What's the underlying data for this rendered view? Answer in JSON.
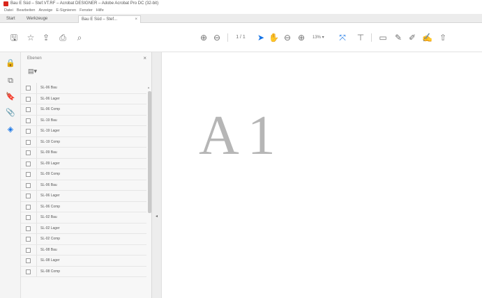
{
  "window": {
    "title": "Bau E Süd – Stef.VT.RF – Acrobat DESIGNER – Adobe Acrobat Pro DC (32-bit)"
  },
  "menu": {
    "items": [
      "Datei",
      "Bearbeiten",
      "Anzeige",
      "E-Signieren",
      "Fenster",
      "Hilfe"
    ]
  },
  "tabs": {
    "home": "Start",
    "tools": "Werkzeuge",
    "document": "Bau E Süd – Stef...",
    "close": "×"
  },
  "toolbar": {
    "zoom_value": "13%"
  },
  "layers_panel": {
    "label": "Ebenen",
    "close": "×",
    "items": [
      {
        "label": "SL-06 Bau"
      },
      {
        "label": "SL-06 Lager"
      },
      {
        "label": "SL-06 Comp"
      },
      {
        "label": "SL-19 Bau"
      },
      {
        "label": "SL-19 Lager"
      },
      {
        "label": "SL-19 Comp"
      },
      {
        "label": "SL-09 Bau"
      },
      {
        "label": "SL-09 Lager"
      },
      {
        "label": "SL-09 Comp"
      },
      {
        "label": "SL-06 Bau"
      },
      {
        "label": "SL-06 Lager"
      },
      {
        "label": "SL-06 Comp"
      },
      {
        "label": "SL-02 Bau"
      },
      {
        "label": "SL-02 Lager"
      },
      {
        "label": "SL-02 Comp"
      },
      {
        "label": "SL-08 Bau"
      },
      {
        "label": "SL-08 Lager"
      },
      {
        "label": "SL-08 Comp"
      }
    ]
  },
  "page": {
    "text": "A1"
  },
  "colors": {
    "accent": "#1473e6",
    "app_icon": "#d9261c"
  }
}
